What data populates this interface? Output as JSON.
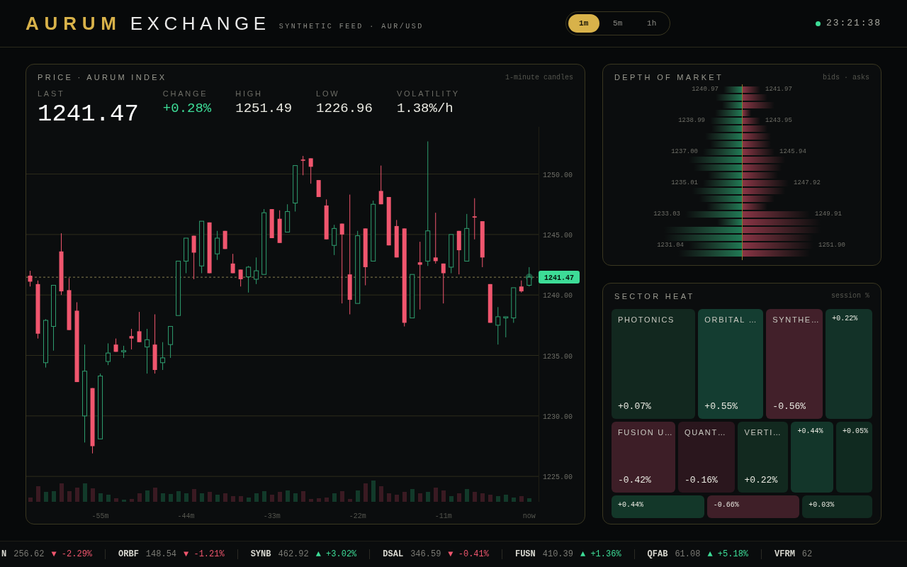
{
  "header": {
    "brand_primary": "AURUM",
    "brand_secondary": "EXCHANGE",
    "subtitle": "SYNTHETIC FEED · AUR/USD",
    "timeframes": [
      {
        "label": "1m",
        "selected": true
      },
      {
        "label": "5m",
        "selected": false
      },
      {
        "label": "1h",
        "selected": false
      }
    ],
    "clock": {
      "time": "23:21:38",
      "live": true
    }
  },
  "price_panel": {
    "title": "PRICE · AURUM INDEX",
    "note": "1-minute candles",
    "stats": [
      {
        "label": "LAST",
        "value": "1241.47",
        "kind": "main"
      },
      {
        "label": "CHANGE",
        "value": "+0.28%",
        "kind": "up"
      },
      {
        "label": "HIGH",
        "value": "1251.49",
        "kind": "plain"
      },
      {
        "label": "LOW",
        "value": "1226.96",
        "kind": "plain"
      },
      {
        "label": "VOLATILITY",
        "value": "1.38%/h",
        "kind": "plain"
      }
    ],
    "chart_data": {
      "type": "candlestick",
      "x": [
        -64,
        -63,
        -62,
        -61,
        -60,
        -59,
        -58,
        -57,
        -56,
        -55,
        -54,
        -53,
        -52,
        -51,
        -50,
        -49,
        -48,
        -47,
        -46,
        -45,
        -44,
        -43,
        -42,
        -41,
        -40,
        -39,
        -38,
        -37,
        -36,
        -35,
        -34,
        -33,
        -32,
        -31,
        -30,
        -29,
        -28,
        -27,
        -26,
        -25,
        -24,
        -23,
        -22,
        -21,
        -20,
        -19,
        -18,
        -17,
        -16,
        -15,
        -14,
        -13,
        -12,
        -11,
        -10,
        -9,
        -8,
        -7,
        -6,
        -5,
        -4,
        -3,
        -2,
        -1,
        0
      ],
      "ohlc": [
        [
          1241.6,
          1242,
          1240.7,
          1241.1
        ],
        [
          1240.9,
          1241.2,
          1236.4,
          1236.8
        ],
        [
          1234.4,
          1238,
          1234,
          1237.9
        ],
        [
          1237.4,
          1240.8,
          1235.4,
          1240.8
        ],
        [
          1243.6,
          1245.1,
          1240,
          1240.3
        ],
        [
          1240.4,
          1241.4,
          1237.1,
          1237.1
        ],
        [
          1238.7,
          1239.4,
          1232.8,
          1232.8
        ],
        [
          1230,
          1235.9,
          1227.8,
          1233.7
        ],
        [
          1232.3,
          1232.3,
          1226.9,
          1227.5
        ],
        [
          1228.1,
          1233.5,
          1228.1,
          1233.3
        ],
        [
          1234.5,
          1236,
          1234.2,
          1235.2
        ],
        [
          1235.9,
          1236.4,
          1235.3,
          1235.3
        ],
        [
          1235.3,
          1235.8,
          1234.8,
          1235.4
        ],
        [
          1236.6,
          1237.2,
          1235.5,
          1236.4
        ],
        [
          1237,
          1238.6,
          1236.1,
          1236.1
        ],
        [
          1235.7,
          1237.2,
          1233.5,
          1236.3
        ],
        [
          1235.9,
          1238.4,
          1233.5,
          1233.8
        ],
        [
          1234.4,
          1236.1,
          1233.8,
          1234.8
        ],
        [
          1235.9,
          1237.4,
          1234.8,
          1237.4
        ],
        [
          1238.3,
          1242.8,
          1238.3,
          1242.8
        ],
        [
          1242.8,
          1244.7,
          1241.8,
          1244.7
        ],
        [
          1244.9,
          1244.9,
          1241.3,
          1243.5
        ],
        [
          1242.4,
          1246.1,
          1241.8,
          1246.1
        ],
        [
          1246,
          1246,
          1241.8,
          1241.8
        ],
        [
          1243.4,
          1245.3,
          1242.9,
          1244.7
        ],
        [
          1245.3,
          1245.3,
          1243.8,
          1243.8
        ],
        [
          1242.6,
          1243.4,
          1241.8,
          1241.8
        ],
        [
          1242.1,
          1242.1,
          1240.7,
          1241.3
        ],
        [
          1241.5,
          1242.4,
          1240.2,
          1242.3
        ],
        [
          1241.3,
          1243.1,
          1240.9,
          1242
        ],
        [
          1241.7,
          1247.1,
          1241.7,
          1246.8
        ],
        [
          1247.1,
          1247.1,
          1244.7,
          1244.7
        ],
        [
          1246.3,
          1247,
          1244.3,
          1244.3
        ],
        [
          1245.2,
          1247.5,
          1245.2,
          1246.9
        ],
        [
          1247.6,
          1250.7,
          1246.9,
          1250.7
        ],
        [
          1251.2,
          1251.5,
          1249.9,
          1251.1
        ],
        [
          1251.3,
          1251.3,
          1249.2,
          1250.6
        ],
        [
          1249.5,
          1249.5,
          1248.1,
          1248.1
        ],
        [
          1247.4,
          1247.9,
          1244.6,
          1244.6
        ],
        [
          1244.1,
          1245.8,
          1243.3,
          1245.5
        ],
        [
          1245.9,
          1245.9,
          1239.3,
          1245
        ],
        [
          1241.7,
          1248.3,
          1238.4,
          1239.6
        ],
        [
          1239.3,
          1245.3,
          1239.3,
          1244.9
        ],
        [
          1245.5,
          1245.5,
          1240.8,
          1242.3
        ],
        [
          1242.8,
          1247.8,
          1242.8,
          1247.5
        ],
        [
          1248.6,
          1250.7,
          1247.5,
          1247.5
        ],
        [
          1248.1,
          1248.1,
          1244.1,
          1244.1
        ],
        [
          1245.7,
          1246.2,
          1243.1,
          1243.1
        ],
        [
          1245.5,
          1245.5,
          1237.4,
          1237.7
        ],
        [
          1238.1,
          1241.7,
          1238.1,
          1241.7
        ],
        [
          1242.7,
          1244.4,
          1238.8,
          1242.5
        ],
        [
          1242.8,
          1252.7,
          1242.4,
          1245.3
        ],
        [
          1243.1,
          1246.8,
          1242.6,
          1242.8
        ],
        [
          1242.6,
          1242.6,
          1239.3,
          1241.8
        ],
        [
          1242.3,
          1245,
          1241.8,
          1245
        ],
        [
          1245.3,
          1245.3,
          1241.7,
          1243.7
        ],
        [
          1242.8,
          1246.7,
          1242.8,
          1245.5
        ],
        [
          1246.5,
          1248,
          1244.6,
          1246.4
        ],
        [
          1246.1,
          1246.1,
          1242.3,
          1243.1
        ],
        [
          1240.9,
          1240.9,
          1237.7,
          1237.7
        ],
        [
          1237.5,
          1239,
          1235.9,
          1238.2
        ],
        [
          1238.1,
          1238.2,
          1236.5,
          1238.2
        ],
        [
          1238.1,
          1240.6,
          1237.7,
          1240.6
        ],
        [
          1240.7,
          1241.2,
          1240.2,
          1240.3
        ],
        [
          1240.8,
          1242.3,
          1240.7,
          1241.47
        ]
      ],
      "xlim": [
        -64.5,
        1.2
      ],
      "ylim": [
        1222.9,
        1253.9
      ],
      "grid": true,
      "ref_lines": [
        {
          "axis": "y",
          "value": 1241.47
        }
      ],
      "yticks": [
        {
          "value": 1250,
          "label": "1250.00"
        },
        {
          "value": 1245,
          "label": "1245.00"
        },
        {
          "value": 1240,
          "label": "1240.00"
        },
        {
          "value": 1235,
          "label": "1235.00"
        },
        {
          "value": 1230,
          "label": "1230.00"
        },
        {
          "value": 1225,
          "label": "1225.00"
        }
      ],
      "xticks": [
        {
          "value": -55,
          "label": "-55m"
        },
        {
          "value": -44,
          "label": "-44m"
        },
        {
          "value": -33,
          "label": "-33m"
        },
        {
          "value": -22,
          "label": "-22m"
        },
        {
          "value": -11,
          "label": "-11m"
        },
        {
          "value": 0,
          "label": "now"
        }
      ]
    },
    "price_tag": "1241.47"
  },
  "depth_panel": {
    "title": "DEPTH OF MARKET",
    "note": "bids · asks",
    "bid_labels": [
      "1240.97",
      "1238.99",
      "1237.00",
      "1235.01",
      "1233.03",
      "1231.04"
    ],
    "ask_labels": [
      "1241.97",
      "1243.95",
      "1245.94",
      "1247.92",
      "1249.91",
      "1251.90"
    ]
  },
  "sector_panel": {
    "title": "SECTOR HEAT",
    "note": "session %",
    "tiles": [
      {
        "name": "PHOTONICS",
        "value": "+0.07%",
        "color": "#12281f"
      },
      {
        "name": "ORBITAL …",
        "value": "+0.55%",
        "color": "#143d31"
      },
      {
        "name": "SYNTHE…",
        "value": "-0.56%",
        "color": "#42202a"
      },
      {
        "value": "+0.22%",
        "color": "#133228"
      },
      {
        "name": "FUSION U…",
        "value": "-0.42%",
        "color": "#3d1e27"
      },
      {
        "name": "QUANT…",
        "value": "-0.16%",
        "color": "#2a161d"
      },
      {
        "name": "VERTI…",
        "value": "+0.22%",
        "color": "#12291f"
      },
      {
        "value": "+0.44%",
        "color": "#13362a"
      },
      {
        "value": "+0.05%",
        "color": "#102a20"
      },
      {
        "value": "+0.44%",
        "color": "#133729"
      },
      {
        "value": "-0.66%",
        "color": "#3f1f28"
      },
      {
        "value": "+0.03%",
        "color": "#112a20"
      }
    ]
  },
  "ticker": [
    {
      "symbol": "N",
      "price": "256.62",
      "arrow": "▼",
      "change": "-2.29%",
      "up": false
    },
    {
      "symbol": "ORBF",
      "price": "148.54",
      "arrow": "▼",
      "change": "-1.21%",
      "up": false
    },
    {
      "symbol": "SYNB",
      "price": "462.92",
      "arrow": "▲",
      "change": "+3.02%",
      "up": true
    },
    {
      "symbol": "DSAL",
      "price": "346.59",
      "arrow": "▼",
      "change": "-0.41%",
      "up": false
    },
    {
      "symbol": "FUSN",
      "price": "410.39",
      "arrow": "▲",
      "change": "+1.36%",
      "up": true
    },
    {
      "symbol": "QFAB",
      "price": "61.08",
      "arrow": "▲",
      "change": "+5.18%",
      "up": true
    },
    {
      "symbol": "VFRM",
      "price": "62"
    }
  ]
}
